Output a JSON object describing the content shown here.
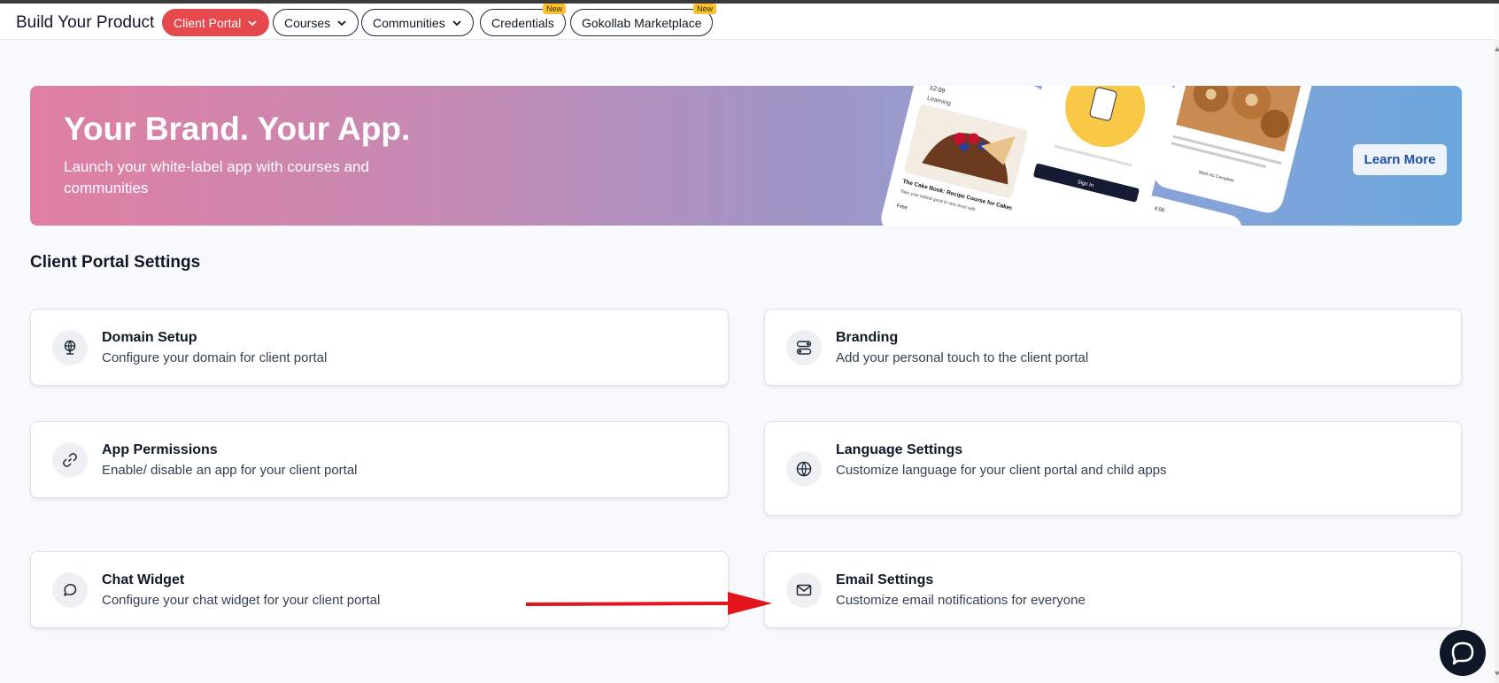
{
  "header": {
    "title": "Build Your Product",
    "tabs": [
      {
        "label": "Client Portal",
        "active": true,
        "dropdown": true,
        "badge": ""
      },
      {
        "label": "Courses",
        "active": false,
        "dropdown": true,
        "badge": ""
      },
      {
        "label": "Communities",
        "active": false,
        "dropdown": true,
        "badge": ""
      },
      {
        "label": "Credentials",
        "active": false,
        "dropdown": false,
        "badge": "New"
      },
      {
        "label": "Gokollab Marketplace",
        "active": false,
        "dropdown": false,
        "badge": "New"
      }
    ]
  },
  "banner": {
    "headline": "Your Brand. Your App.",
    "subtext": "Launch your white-label app with courses and communities",
    "cta": "Learn More",
    "phone_texts": {
      "time1": "12:09",
      "learning": "Learning",
      "book_title": "The Cake Book: Recipe Course for Cakes",
      "book_desc": "Take your baked good to new level with the decadent buttercream, meringues, ganache and more",
      "free": "Free",
      "sign_in": "Sign In",
      "mark_complete": "Mark As Complete",
      "time2": "4:08"
    }
  },
  "section": {
    "title": "Client Portal Settings"
  },
  "cards": {
    "domain": {
      "title": "Domain Setup",
      "desc": "Configure your domain for client portal"
    },
    "branding": {
      "title": "Branding",
      "desc": "Add your personal touch to the client portal"
    },
    "permissions": {
      "title": "App Permissions",
      "desc": "Enable/ disable an app for your client portal"
    },
    "language": {
      "title": "Language Settings",
      "desc": "Customize language for your client portal and child apps"
    },
    "chat": {
      "title": "Chat Widget",
      "desc": "Configure your chat widget for your client portal"
    },
    "email": {
      "title": "Email Settings",
      "desc": "Customize email notifications for everyone"
    }
  },
  "colors": {
    "accent": "#e5484d",
    "badge": "#f9c22e",
    "arrow": "#e3141b",
    "link": "#1f4fa8"
  }
}
